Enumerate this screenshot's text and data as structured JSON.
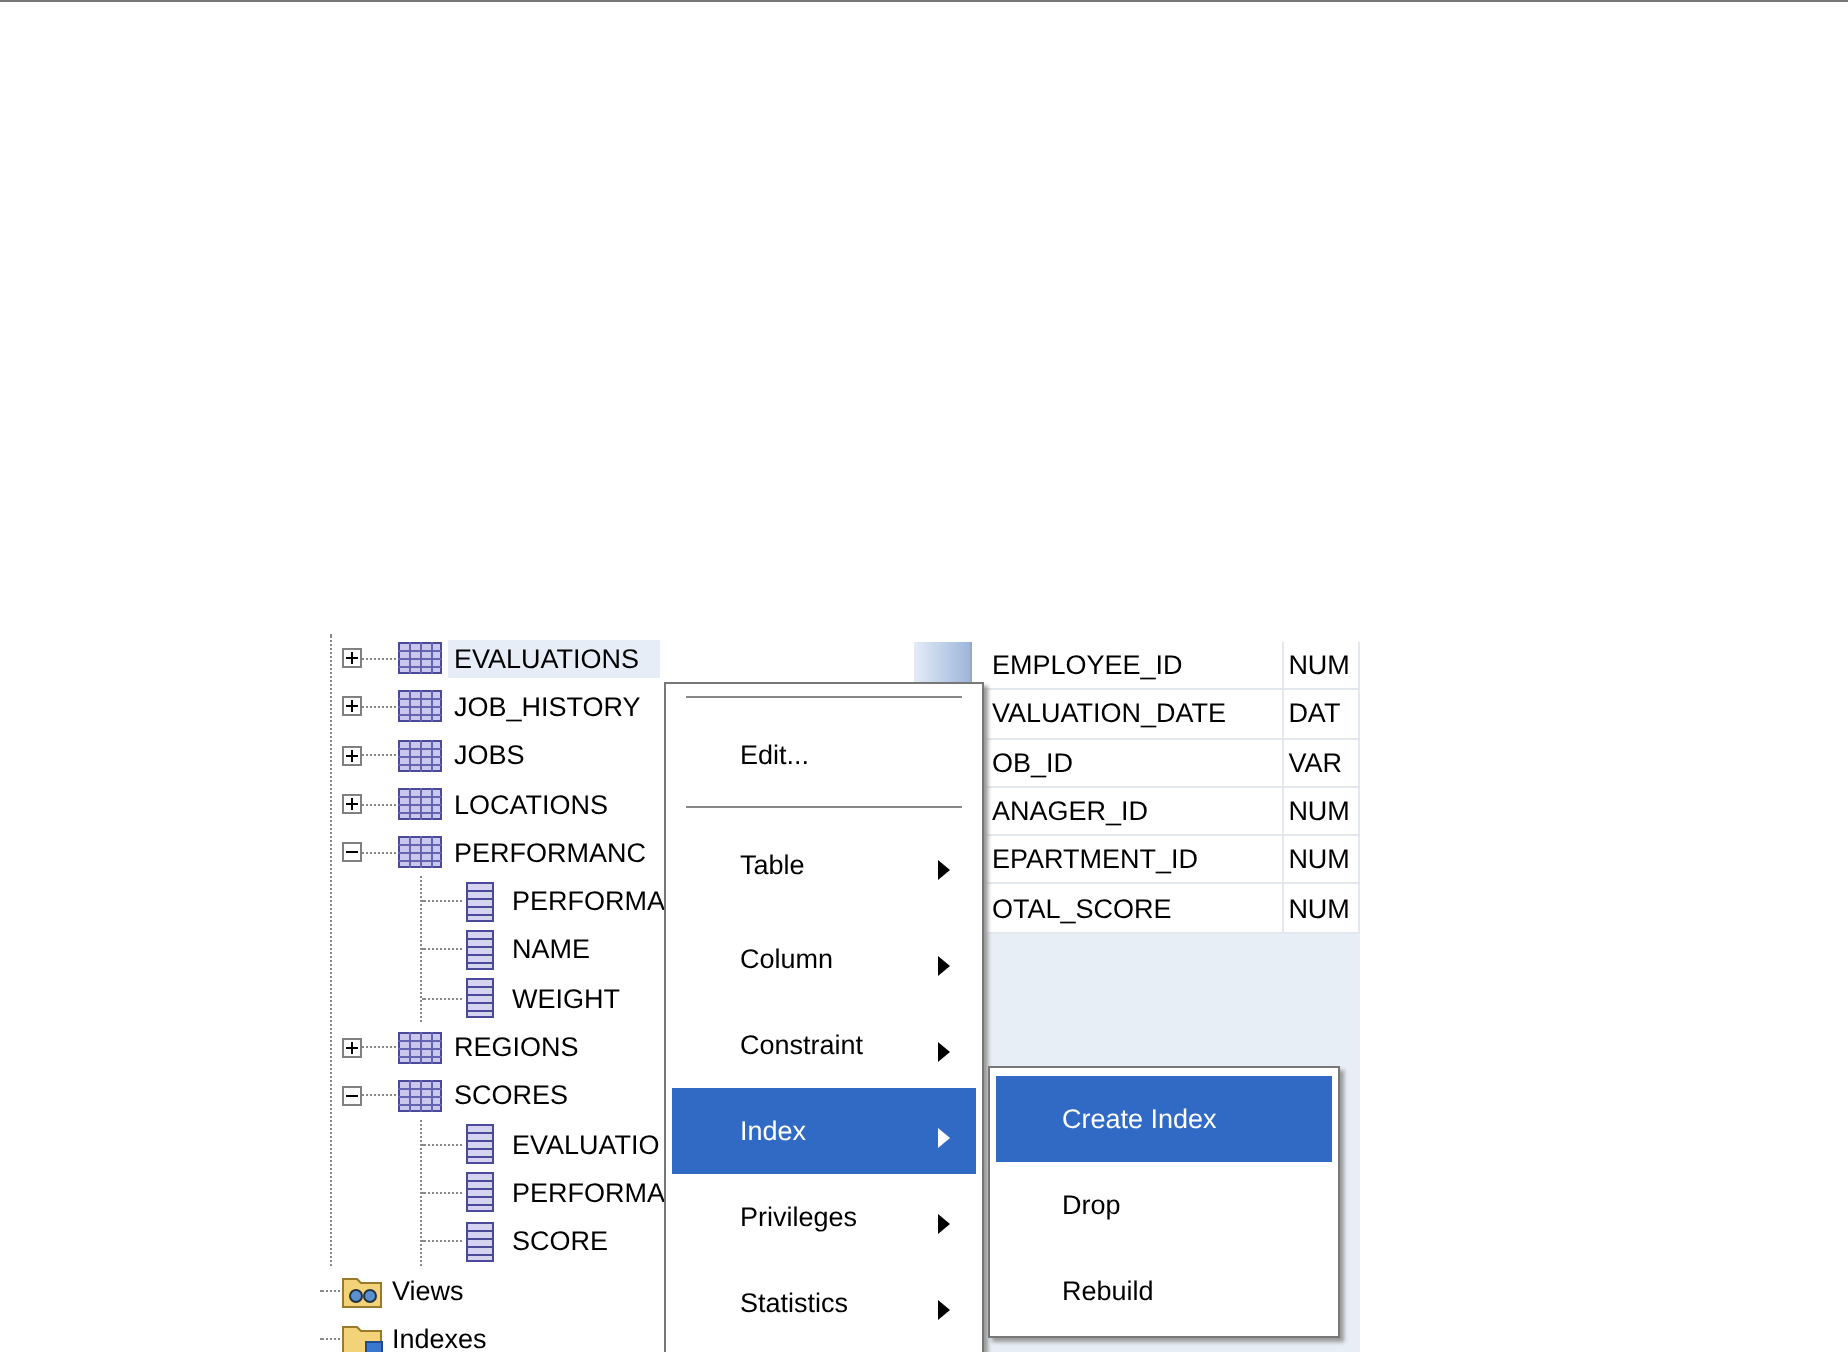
{
  "tree": {
    "items": [
      {
        "children": [
          {
            "kind": "table",
            "label": "EVALUATIONS",
            "expanded": false,
            "selected": true
          },
          {
            "kind": "table",
            "label": "JOB_HISTORY",
            "expanded": false,
            "selected": false
          },
          {
            "kind": "table",
            "label": "JOBS",
            "expanded": false,
            "selected": false
          },
          {
            "kind": "table",
            "label": "LOCATIONS",
            "expanded": false,
            "selected": false
          },
          {
            "kind": "table",
            "label": "PERFORMANC",
            "expanded": true,
            "selected": false,
            "children": [
              {
                "kind": "column",
                "label": "PERFORMA"
              },
              {
                "kind": "column",
                "label": "NAME"
              },
              {
                "kind": "column",
                "label": "WEIGHT"
              }
            ]
          },
          {
            "kind": "table",
            "label": "REGIONS",
            "expanded": false,
            "selected": false
          },
          {
            "kind": "table",
            "label": "SCORES",
            "expanded": true,
            "selected": false,
            "children": [
              {
                "kind": "column",
                "label": "EVALUATIO"
              },
              {
                "kind": "column",
                "label": "PERFORMA"
              },
              {
                "kind": "column",
                "label": "SCORE"
              }
            ]
          }
        ]
      },
      {
        "kind": "views",
        "label": "Views"
      },
      {
        "kind": "indexes",
        "label": "Indexes"
      }
    ]
  },
  "grid": {
    "rows": [
      {
        "column_1": "EMPLOYEE_ID",
        "column_2": "NUM"
      },
      {
        "column_1": "VALUATION_DATE",
        "column_2": "DAT"
      },
      {
        "column_1": "OB_ID",
        "column_2": "VAR"
      },
      {
        "column_1": "ANAGER_ID",
        "column_2": "NUM"
      },
      {
        "column_1": "EPARTMENT_ID",
        "column_2": "NUM"
      },
      {
        "column_1": "OTAL_SCORE",
        "column_2": "NUM"
      }
    ]
  },
  "context_menu": {
    "items": [
      {
        "kind": "separator"
      },
      {
        "kind": "item",
        "label": "Edit...",
        "submenu": false,
        "selected": false
      },
      {
        "kind": "separator"
      },
      {
        "kind": "item",
        "label": "Table",
        "submenu": true,
        "selected": false
      },
      {
        "kind": "item",
        "label": "Column",
        "submenu": true,
        "selected": false
      },
      {
        "kind": "item",
        "label": "Constraint",
        "submenu": true,
        "selected": false
      },
      {
        "kind": "item",
        "label": "Index",
        "submenu": true,
        "selected": true
      },
      {
        "kind": "item",
        "label": "Privileges",
        "submenu": true,
        "selected": false
      },
      {
        "kind": "item",
        "label": "Statistics",
        "submenu": true,
        "selected": false
      }
    ]
  },
  "submenu": {
    "items": [
      {
        "label": "Create Index",
        "selected": true
      },
      {
        "label": "Drop",
        "selected": false
      },
      {
        "label": "Rebuild",
        "selected": false
      }
    ]
  }
}
